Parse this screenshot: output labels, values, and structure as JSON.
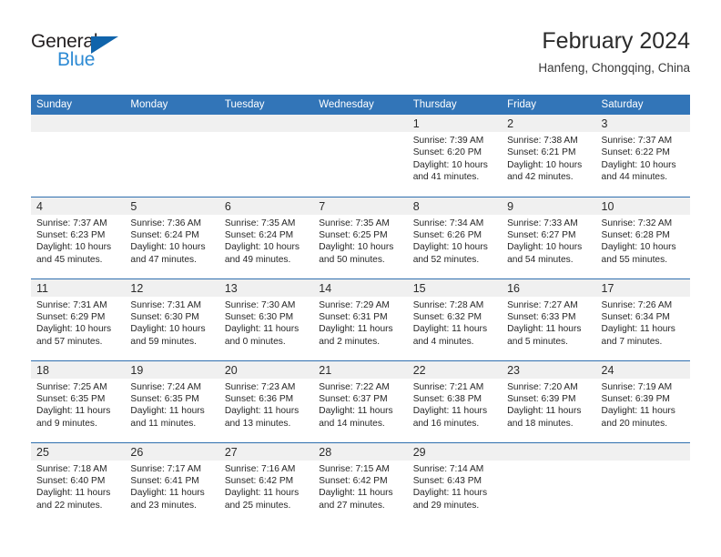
{
  "brand": {
    "word_one": "General",
    "word_two": "Blue",
    "triangle_color": "#1064ab",
    "blue_text_color": "#2e8bd4"
  },
  "header": {
    "title": "February 2024",
    "location": "Hanfeng, Chongqing, China"
  },
  "theme": {
    "header_blue": "#3275b8",
    "row_rule_blue": "#2f6fae",
    "day_band_grey": "#f0f0f0"
  },
  "columns": [
    "Sunday",
    "Monday",
    "Tuesday",
    "Wednesday",
    "Thursday",
    "Friday",
    "Saturday"
  ],
  "labels": {
    "sunrise_prefix": "Sunrise:",
    "sunset_prefix": "Sunset:",
    "daylight_prefix": "Daylight:"
  },
  "weeks": [
    [
      {
        "day": "",
        "blank": true
      },
      {
        "day": "",
        "blank": true
      },
      {
        "day": "",
        "blank": true
      },
      {
        "day": "",
        "blank": true
      },
      {
        "day": "1",
        "sunrise": "Sunrise: 7:39 AM",
        "sunset": "Sunset: 6:20 PM",
        "daylight_line1": "Daylight: 10 hours",
        "daylight_line2": "and 41 minutes."
      },
      {
        "day": "2",
        "sunrise": "Sunrise: 7:38 AM",
        "sunset": "Sunset: 6:21 PM",
        "daylight_line1": "Daylight: 10 hours",
        "daylight_line2": "and 42 minutes."
      },
      {
        "day": "3",
        "sunrise": "Sunrise: 7:37 AM",
        "sunset": "Sunset: 6:22 PM",
        "daylight_line1": "Daylight: 10 hours",
        "daylight_line2": "and 44 minutes."
      }
    ],
    [
      {
        "day": "4",
        "sunrise": "Sunrise: 7:37 AM",
        "sunset": "Sunset: 6:23 PM",
        "daylight_line1": "Daylight: 10 hours",
        "daylight_line2": "and 45 minutes."
      },
      {
        "day": "5",
        "sunrise": "Sunrise: 7:36 AM",
        "sunset": "Sunset: 6:24 PM",
        "daylight_line1": "Daylight: 10 hours",
        "daylight_line2": "and 47 minutes."
      },
      {
        "day": "6",
        "sunrise": "Sunrise: 7:35 AM",
        "sunset": "Sunset: 6:24 PM",
        "daylight_line1": "Daylight: 10 hours",
        "daylight_line2": "and 49 minutes."
      },
      {
        "day": "7",
        "sunrise": "Sunrise: 7:35 AM",
        "sunset": "Sunset: 6:25 PM",
        "daylight_line1": "Daylight: 10 hours",
        "daylight_line2": "and 50 minutes."
      },
      {
        "day": "8",
        "sunrise": "Sunrise: 7:34 AM",
        "sunset": "Sunset: 6:26 PM",
        "daylight_line1": "Daylight: 10 hours",
        "daylight_line2": "and 52 minutes."
      },
      {
        "day": "9",
        "sunrise": "Sunrise: 7:33 AM",
        "sunset": "Sunset: 6:27 PM",
        "daylight_line1": "Daylight: 10 hours",
        "daylight_line2": "and 54 minutes."
      },
      {
        "day": "10",
        "sunrise": "Sunrise: 7:32 AM",
        "sunset": "Sunset: 6:28 PM",
        "daylight_line1": "Daylight: 10 hours",
        "daylight_line2": "and 55 minutes."
      }
    ],
    [
      {
        "day": "11",
        "sunrise": "Sunrise: 7:31 AM",
        "sunset": "Sunset: 6:29 PM",
        "daylight_line1": "Daylight: 10 hours",
        "daylight_line2": "and 57 minutes."
      },
      {
        "day": "12",
        "sunrise": "Sunrise: 7:31 AM",
        "sunset": "Sunset: 6:30 PM",
        "daylight_line1": "Daylight: 10 hours",
        "daylight_line2": "and 59 minutes."
      },
      {
        "day": "13",
        "sunrise": "Sunrise: 7:30 AM",
        "sunset": "Sunset: 6:30 PM",
        "daylight_line1": "Daylight: 11 hours",
        "daylight_line2": "and 0 minutes."
      },
      {
        "day": "14",
        "sunrise": "Sunrise: 7:29 AM",
        "sunset": "Sunset: 6:31 PM",
        "daylight_line1": "Daylight: 11 hours",
        "daylight_line2": "and 2 minutes."
      },
      {
        "day": "15",
        "sunrise": "Sunrise: 7:28 AM",
        "sunset": "Sunset: 6:32 PM",
        "daylight_line1": "Daylight: 11 hours",
        "daylight_line2": "and 4 minutes."
      },
      {
        "day": "16",
        "sunrise": "Sunrise: 7:27 AM",
        "sunset": "Sunset: 6:33 PM",
        "daylight_line1": "Daylight: 11 hours",
        "daylight_line2": "and 5 minutes."
      },
      {
        "day": "17",
        "sunrise": "Sunrise: 7:26 AM",
        "sunset": "Sunset: 6:34 PM",
        "daylight_line1": "Daylight: 11 hours",
        "daylight_line2": "and 7 minutes."
      }
    ],
    [
      {
        "day": "18",
        "sunrise": "Sunrise: 7:25 AM",
        "sunset": "Sunset: 6:35 PM",
        "daylight_line1": "Daylight: 11 hours",
        "daylight_line2": "and 9 minutes."
      },
      {
        "day": "19",
        "sunrise": "Sunrise: 7:24 AM",
        "sunset": "Sunset: 6:35 PM",
        "daylight_line1": "Daylight: 11 hours",
        "daylight_line2": "and 11 minutes."
      },
      {
        "day": "20",
        "sunrise": "Sunrise: 7:23 AM",
        "sunset": "Sunset: 6:36 PM",
        "daylight_line1": "Daylight: 11 hours",
        "daylight_line2": "and 13 minutes."
      },
      {
        "day": "21",
        "sunrise": "Sunrise: 7:22 AM",
        "sunset": "Sunset: 6:37 PM",
        "daylight_line1": "Daylight: 11 hours",
        "daylight_line2": "and 14 minutes."
      },
      {
        "day": "22",
        "sunrise": "Sunrise: 7:21 AM",
        "sunset": "Sunset: 6:38 PM",
        "daylight_line1": "Daylight: 11 hours",
        "daylight_line2": "and 16 minutes."
      },
      {
        "day": "23",
        "sunrise": "Sunrise: 7:20 AM",
        "sunset": "Sunset: 6:39 PM",
        "daylight_line1": "Daylight: 11 hours",
        "daylight_line2": "and 18 minutes."
      },
      {
        "day": "24",
        "sunrise": "Sunrise: 7:19 AM",
        "sunset": "Sunset: 6:39 PM",
        "daylight_line1": "Daylight: 11 hours",
        "daylight_line2": "and 20 minutes."
      }
    ],
    [
      {
        "day": "25",
        "sunrise": "Sunrise: 7:18 AM",
        "sunset": "Sunset: 6:40 PM",
        "daylight_line1": "Daylight: 11 hours",
        "daylight_line2": "and 22 minutes."
      },
      {
        "day": "26",
        "sunrise": "Sunrise: 7:17 AM",
        "sunset": "Sunset: 6:41 PM",
        "daylight_line1": "Daylight: 11 hours",
        "daylight_line2": "and 23 minutes."
      },
      {
        "day": "27",
        "sunrise": "Sunrise: 7:16 AM",
        "sunset": "Sunset: 6:42 PM",
        "daylight_line1": "Daylight: 11 hours",
        "daylight_line2": "and 25 minutes."
      },
      {
        "day": "28",
        "sunrise": "Sunrise: 7:15 AM",
        "sunset": "Sunset: 6:42 PM",
        "daylight_line1": "Daylight: 11 hours",
        "daylight_line2": "and 27 minutes."
      },
      {
        "day": "29",
        "sunrise": "Sunrise: 7:14 AM",
        "sunset": "Sunset: 6:43 PM",
        "daylight_line1": "Daylight: 11 hours",
        "daylight_line2": "and 29 minutes."
      },
      {
        "day": "",
        "blank": true
      },
      {
        "day": "",
        "blank": true
      }
    ]
  ]
}
